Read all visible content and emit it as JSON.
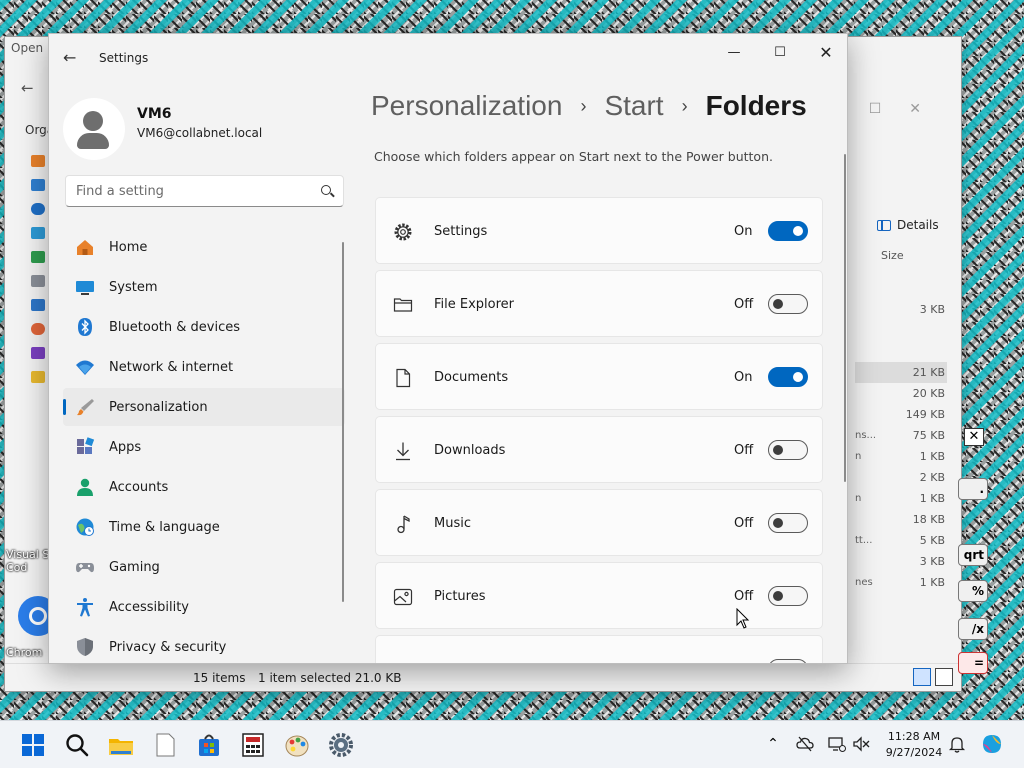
{
  "explorer": {
    "open_label": "Open",
    "organize_label": "Orga",
    "details_label": "Details",
    "size_header": "Size",
    "rows": [
      {
        "name": "",
        "size": "3 KB",
        "selected": false
      },
      {
        "name": "",
        "size": "",
        "selected": false
      },
      {
        "name": "",
        "size": "",
        "selected": false
      },
      {
        "name": "",
        "size": "21 KB",
        "selected": true
      },
      {
        "name": "",
        "size": "20 KB",
        "selected": false
      },
      {
        "name": "",
        "size": "149 KB",
        "selected": false
      },
      {
        "name": "ns...",
        "size": "75 KB",
        "selected": false
      },
      {
        "name": "n",
        "size": "1 KB",
        "selected": false
      },
      {
        "name": "",
        "size": "2 KB",
        "selected": false
      },
      {
        "name": "n",
        "size": "1 KB",
        "selected": false
      },
      {
        "name": "",
        "size": "18 KB",
        "selected": false
      },
      {
        "name": "tt...",
        "size": "5 KB",
        "selected": false
      },
      {
        "name": "",
        "size": "3 KB",
        "selected": false
      },
      {
        "name": "nes",
        "size": "1 KB",
        "selected": false
      }
    ],
    "status_count": "15 items",
    "status_selected": "1 item selected  21.0 KB"
  },
  "calculator": {
    "close": "✕",
    "keys": [
      ".",
      "qrt",
      "%",
      "/x",
      "="
    ]
  },
  "desktop_icons": [
    {
      "label": "Visual S Cod"
    },
    {
      "label": "Chrom"
    }
  ],
  "settings": {
    "window_title": "Settings",
    "back_icon": "←",
    "minimize": "—",
    "maximize": "☐",
    "close": "✕",
    "user": {
      "name": "VM6",
      "email": "VM6@collabnet.local"
    },
    "search_placeholder": "Find a setting",
    "nav": [
      {
        "label": "Home",
        "icon": "home-icon",
        "active": false
      },
      {
        "label": "System",
        "icon": "system-icon",
        "active": false
      },
      {
        "label": "Bluetooth & devices",
        "icon": "bluetooth-icon",
        "active": false
      },
      {
        "label": "Network & internet",
        "icon": "wifi-icon",
        "active": false
      },
      {
        "label": "Personalization",
        "icon": "brush-icon",
        "active": true
      },
      {
        "label": "Apps",
        "icon": "apps-icon",
        "active": false
      },
      {
        "label": "Accounts",
        "icon": "accounts-icon",
        "active": false
      },
      {
        "label": "Time & language",
        "icon": "globe-clock-icon",
        "active": false
      },
      {
        "label": "Gaming",
        "icon": "gamepad-icon",
        "active": false
      },
      {
        "label": "Accessibility",
        "icon": "accessibility-icon",
        "active": false
      },
      {
        "label": "Privacy & security",
        "icon": "shield-icon",
        "active": false
      }
    ],
    "breadcrumb": {
      "level1": "Personalization",
      "level2": "Start",
      "current": "Folders",
      "separator": "›"
    },
    "description": "Choose which folders appear on Start next to the Power button.",
    "folders": [
      {
        "label": "Settings",
        "icon": "gear-icon",
        "state": "On",
        "on": true
      },
      {
        "label": "File Explorer",
        "icon": "folder-icon",
        "state": "Off",
        "on": false
      },
      {
        "label": "Documents",
        "icon": "document-icon",
        "state": "On",
        "on": true
      },
      {
        "label": "Downloads",
        "icon": "download-icon",
        "state": "Off",
        "on": false
      },
      {
        "label": "Music",
        "icon": "music-note-icon",
        "state": "Off",
        "on": false
      },
      {
        "label": "Pictures",
        "icon": "picture-icon",
        "state": "Off",
        "on": false
      },
      {
        "label": "",
        "icon": "video-icon",
        "state": "",
        "on": false
      }
    ]
  },
  "taskbar": {
    "apps": [
      "start-icon",
      "search-icon",
      "file-explorer-icon",
      "notepad-icon",
      "store-icon",
      "calculator-icon",
      "paint-icon",
      "settings-icon"
    ],
    "time": "11:28 AM",
    "date": "9/27/2024"
  },
  "colors": {
    "accent": "#0067c0",
    "window_bg": "#f3f3f3",
    "card_bg": "#fbfbfb"
  }
}
